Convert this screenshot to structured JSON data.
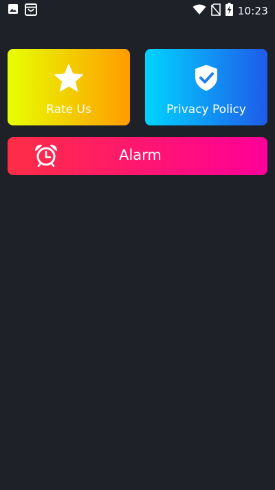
{
  "status_bar": {
    "time": "10:23",
    "left_icons": [
      "image-icon",
      "store-bag-icon"
    ],
    "right_icons": [
      "wifi-icon",
      "no-sim-icon",
      "battery-charging-icon"
    ]
  },
  "tiles": {
    "rate": {
      "label": "Rate Us",
      "icon": "star-icon",
      "gradient": [
        "#e6ff00",
        "#ff9c00"
      ]
    },
    "privacy": {
      "label": "Privacy Policy",
      "icon": "shield-check-icon",
      "gradient": [
        "#00d4ff",
        "#1f5bea"
      ]
    },
    "alarm": {
      "label": "Alarm",
      "icon": "alarm-clock-icon",
      "gradient": [
        "#ff2e45",
        "#ff0099"
      ]
    }
  },
  "colors": {
    "background": "#1f2128",
    "text": "#ffffff"
  }
}
